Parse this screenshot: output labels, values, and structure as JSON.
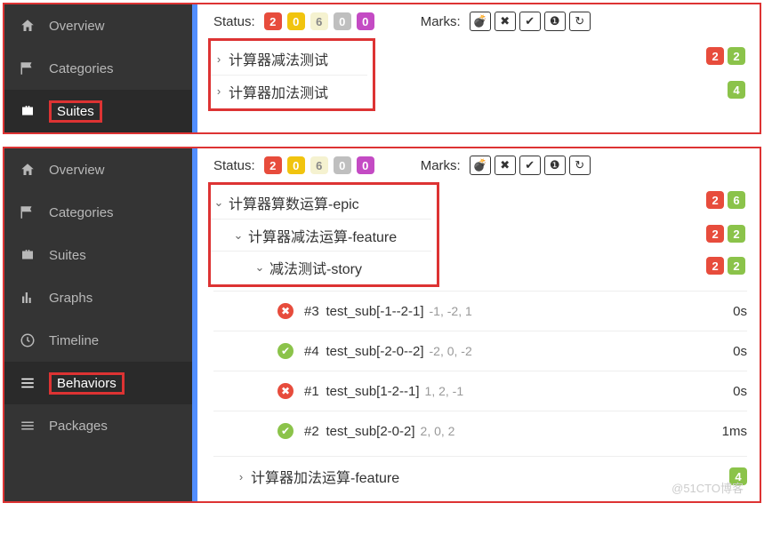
{
  "nav": {
    "overview": "Overview",
    "categories": "Categories",
    "suites": "Suites",
    "graphs": "Graphs",
    "timeline": "Timeline",
    "behaviors": "Behaviors",
    "packages": "Packages"
  },
  "labels": {
    "status": "Status:",
    "marks": "Marks:"
  },
  "status_counts": {
    "red": "2",
    "orange": "0",
    "cream": "6",
    "gray": "0",
    "pink": "0"
  },
  "suites_tree": {
    "row0": {
      "label": "计算器减法测试",
      "b_red": "2",
      "b_lime": "2"
    },
    "row1": {
      "label": "计算器加法测试",
      "b_lime": "4"
    }
  },
  "behaviors_tree": {
    "epic": {
      "label": "计算器算数运算-epic",
      "b_red": "2",
      "b_lime": "6"
    },
    "feature": {
      "label": "计算器减法运算-feature",
      "b_red": "2",
      "b_lime": "2"
    },
    "story": {
      "label": "减法测试-story",
      "b_red": "2",
      "b_lime": "2"
    },
    "t0": {
      "idx": "#3",
      "name": "test_sub[-1--2-1]",
      "params": "-1, -2, 1",
      "dur": "0s"
    },
    "t1": {
      "idx": "#4",
      "name": "test_sub[-2-0--2]",
      "params": "-2, 0, -2",
      "dur": "0s"
    },
    "t2": {
      "idx": "#1",
      "name": "test_sub[1-2--1]",
      "params": "1, 2, -1",
      "dur": "0s"
    },
    "t3": {
      "idx": "#2",
      "name": "test_sub[2-0-2]",
      "params": "2, 0, 2",
      "dur": "1ms"
    },
    "feature2": {
      "label": "计算器加法运算-feature",
      "b_lime": "4"
    }
  },
  "watermark": "@51CTO博客"
}
